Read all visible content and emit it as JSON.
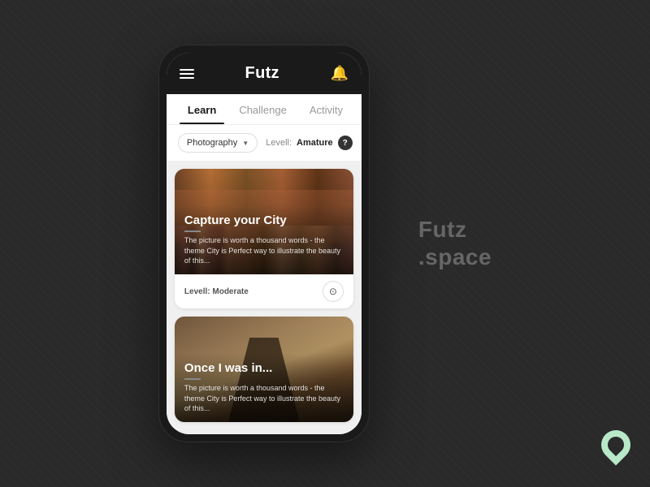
{
  "app": {
    "title": "Futz",
    "notification_icon": "🔔"
  },
  "tabs": [
    {
      "id": "learn",
      "label": "Learn",
      "active": true
    },
    {
      "id": "challenge",
      "label": "Challenge",
      "active": false
    },
    {
      "id": "activity",
      "label": "Activity",
      "active": false
    }
  ],
  "filter": {
    "category": "Photography",
    "level_label": "Levell:",
    "level_value": "Amature",
    "help_symbol": "?"
  },
  "cards": [
    {
      "id": "card-1",
      "title": "Capture your City",
      "description": "The picture is worth a thousand words - the theme City is Perfect way to illustrate the beauty of this...",
      "level_label": "Levell:",
      "level_value": "Moderate",
      "image_type": "city"
    },
    {
      "id": "card-2",
      "title": "Once I was in...",
      "description": "The picture is worth a thousand words - the theme City is Perfect way to illustrate the beauty of this...",
      "level_label": "",
      "level_value": "",
      "image_type": "runner"
    }
  ],
  "brand": {
    "line1": "Futz",
    "line2": ".space"
  },
  "icons": {
    "menu": "☰",
    "bell": "🔔",
    "camera": "⊙",
    "dropdown_arrow": "▼"
  }
}
